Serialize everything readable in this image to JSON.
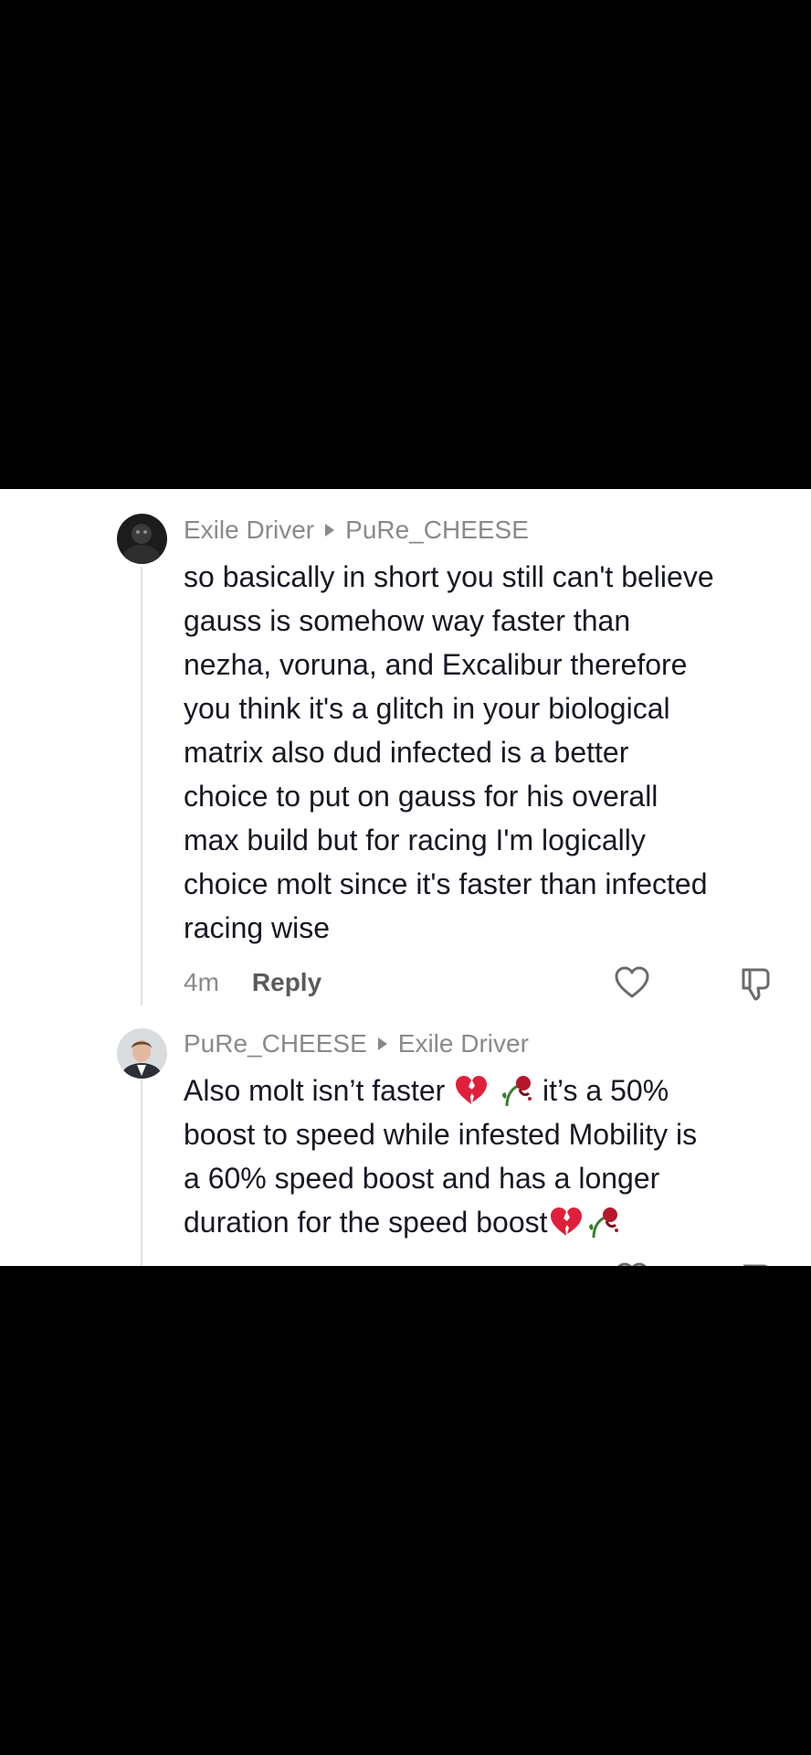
{
  "comments": [
    {
      "author": "Exile Driver",
      "reply_to": "PuRe_CHEESE",
      "lines": [
        "so basically in short you still can't believe",
        "gauss is somehow way faster than",
        "nezha, voruna, and Excalibur therefore",
        "you think it's a glitch in your biological",
        "matrix also dud infected is a better",
        "choice to put on gauss for his overall",
        "max build but for racing I'm logically",
        "choice molt since it's faster than infected",
        "racing wise"
      ],
      "time": "4m",
      "reply_label": "Reply",
      "avatar": "dark-character-avatar",
      "like_icon": "heart-outline-icon",
      "dislike_icon": "thumbs-down-outline-icon"
    },
    {
      "author": "PuRe_CHEESE",
      "reply_to": "Exile Driver",
      "line1_pre": "Also molt isn’t faster ",
      "line1_post": " it’s a 50%",
      "line2": "boost to speed while infested Mobility is",
      "line3": "a 60% speed boost and has a longer",
      "line4_pre": "duration for the speed boost",
      "emojis": [
        "broken-heart-icon",
        "wilted-rose-icon"
      ],
      "avatar": "person-photo-avatar"
    }
  ],
  "colors": {
    "background": "#000000",
    "panel": "#ffffff",
    "text": "#161823",
    "muted": "#8a8a8a",
    "broken_heart": "#e0203a",
    "rose": "#b5162b"
  }
}
